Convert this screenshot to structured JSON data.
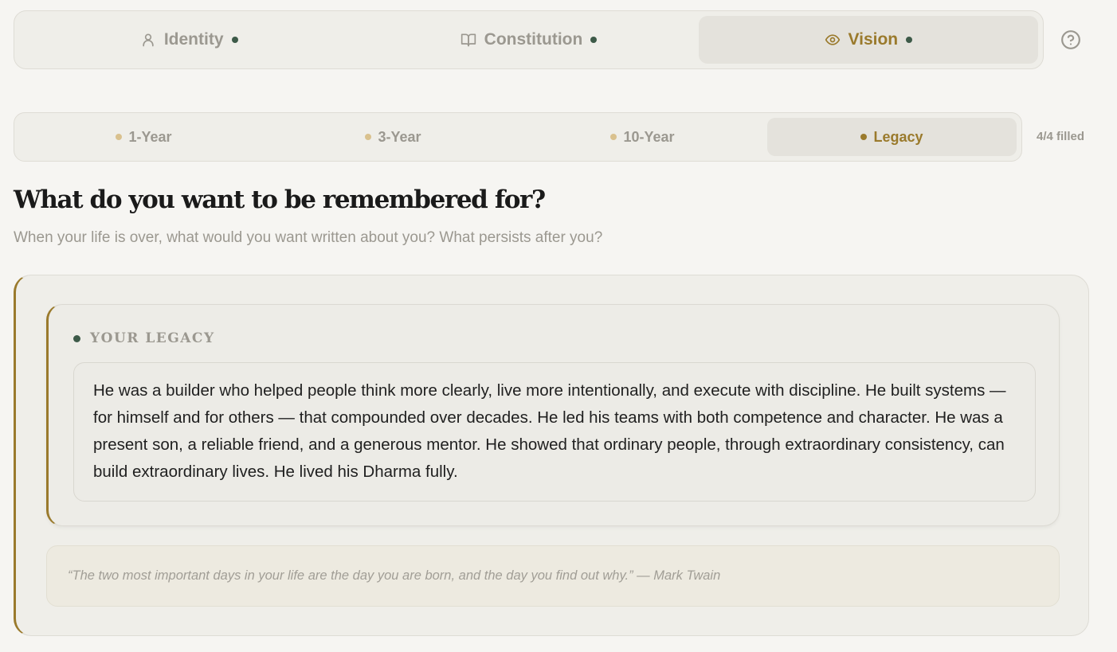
{
  "top_tabs": [
    {
      "label": "Identity",
      "icon": "user-icon",
      "active": false
    },
    {
      "label": "Constitution",
      "icon": "book-icon",
      "active": false
    },
    {
      "label": "Vision",
      "icon": "eye-icon",
      "active": true
    }
  ],
  "sub_tabs": [
    {
      "label": "1-Year",
      "active": false
    },
    {
      "label": "3-Year",
      "active": false
    },
    {
      "label": "10-Year",
      "active": false
    },
    {
      "label": "Legacy",
      "active": true
    }
  ],
  "filled_status": "4/4 filled",
  "heading": {
    "title": "What do you want to be remembered for?",
    "subtitle": "When your life is over, what would you want written about you? What persists after you?"
  },
  "legacy": {
    "label": "YOUR LEGACY",
    "text": "He was a builder who helped people think more clearly, live more intentionally, and execute with discipline. He built systems — for himself and for others — that compounded over decades. He led his teams with both competence and character. He was a present son, a reliable friend, and a generous mentor. He showed that ordinary people, through extraordinary consistency, can build extraordinary lives. He lived his Dharma fully."
  },
  "quote": "“The two most important days in your life are the day you are born, and the day you find out why.” — Mark Twain",
  "colors": {
    "accent_gold": "#9a7a2c",
    "status_green": "#3d5a48",
    "muted_text": "#9b9890",
    "background": "#f6f5f2"
  }
}
